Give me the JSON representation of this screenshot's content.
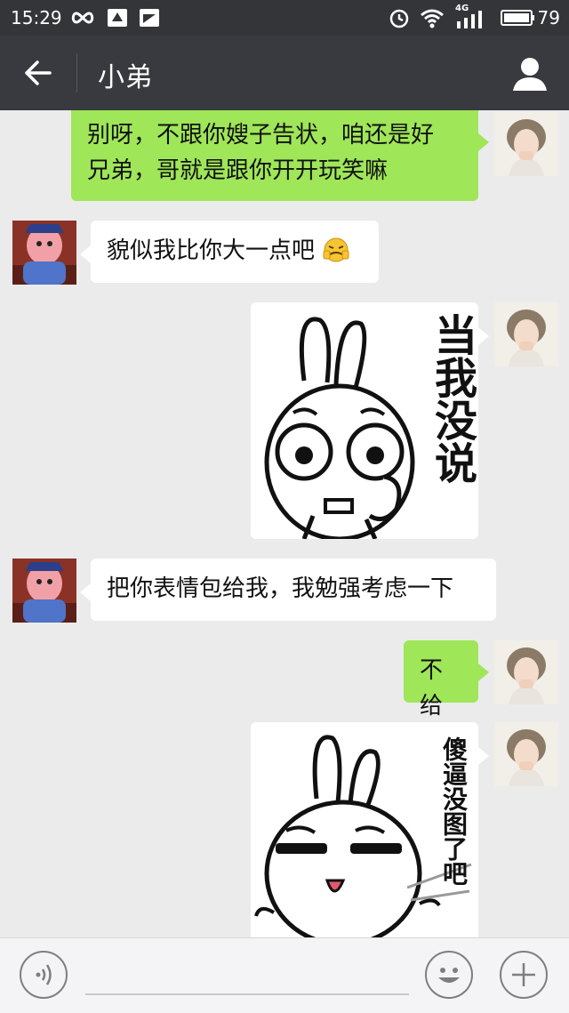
{
  "status_bar": {
    "time": "15:29",
    "battery": "79",
    "network": "4G"
  },
  "header": {
    "title": "小弟"
  },
  "messages": [
    {
      "side": "right",
      "type": "text",
      "text_lines": [
        "别呀，不跟你嫂子告状，咱还是好",
        "兄弟，哥就是跟你开开玩笑嘛"
      ]
    },
    {
      "side": "left",
      "type": "text",
      "text": "貌似我比你大一点吧"
    },
    {
      "side": "right",
      "type": "sticker",
      "caption": "当我没说"
    },
    {
      "side": "left",
      "type": "text",
      "text": "把你表情包给我，我勉强考虑一下"
    },
    {
      "side": "right",
      "type": "text",
      "text": "不给"
    },
    {
      "side": "right",
      "type": "sticker",
      "caption": "傻逼没图了吧"
    }
  ],
  "colors": {
    "header_bg": "#393a3f",
    "status_bg": "#333539",
    "chat_bg": "#ebebeb",
    "sent_bubble": "#9fe658",
    "received_bubble": "#ffffff"
  }
}
